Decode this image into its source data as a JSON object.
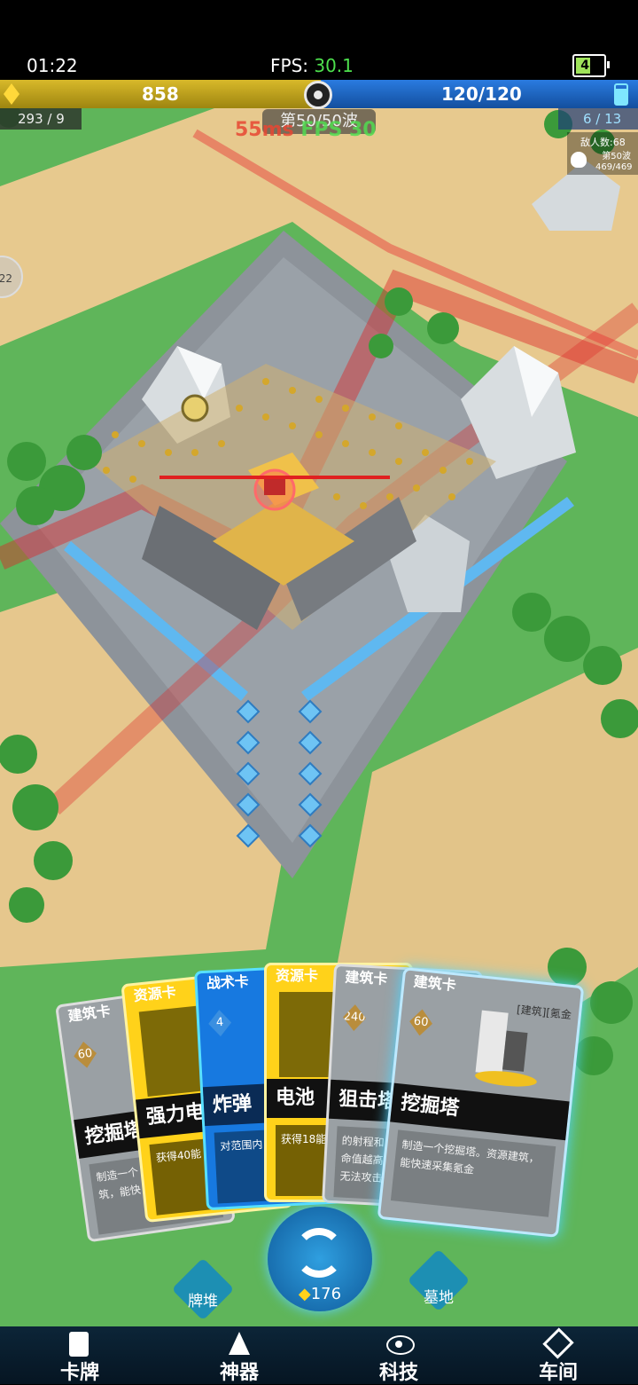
{
  "status_bar": {
    "time": "01:22",
    "fps_label": "FPS:",
    "fps_value": "30.1",
    "battery": "48"
  },
  "resources": {
    "gold": "858",
    "energy": "120/120",
    "left_counter": "293 / 9",
    "right_counter": "6 / 13"
  },
  "wave": {
    "label": "第50/50波",
    "ping": "55ms",
    "fps": "FPS 30"
  },
  "enemy_panel": {
    "count_label": "敌人数:68",
    "wave_label": "第50波",
    "wave_progress": "469/469"
  },
  "side_button": {
    "label": "22"
  },
  "cards": [
    {
      "type": "建筑卡",
      "cost": "60",
      "title": "挖掘塔",
      "desc": "制造一个\n筑，能快"
    },
    {
      "type": "资源卡",
      "title": "强力电",
      "desc": "获得40能"
    },
    {
      "type": "战术卡",
      "cost": "4",
      "title": "炸弹",
      "desc": "对范围内"
    },
    {
      "type": "资源卡",
      "title": "电池",
      "desc": "获得18能"
    },
    {
      "type": "建筑卡",
      "cost": "240",
      "title": "狙击塔",
      "desc": "的射程和\n命值越高\n无法攻击"
    },
    {
      "type": "建筑卡",
      "cost": "60",
      "tags": "[建筑][氪金",
      "title": "挖掘塔",
      "desc": "制造一个挖掘塔。资源建筑，能快速采集氪金"
    }
  ],
  "actions": {
    "deck": "牌堆",
    "refresh_count": "176",
    "graveyard": "墓地"
  },
  "nav": [
    {
      "label": "卡牌",
      "icon": "card-icon"
    },
    {
      "label": "神器",
      "icon": "artifact-icon"
    },
    {
      "label": "科技",
      "icon": "atom-icon"
    },
    {
      "label": "车间",
      "icon": "workshop-icon"
    }
  ]
}
